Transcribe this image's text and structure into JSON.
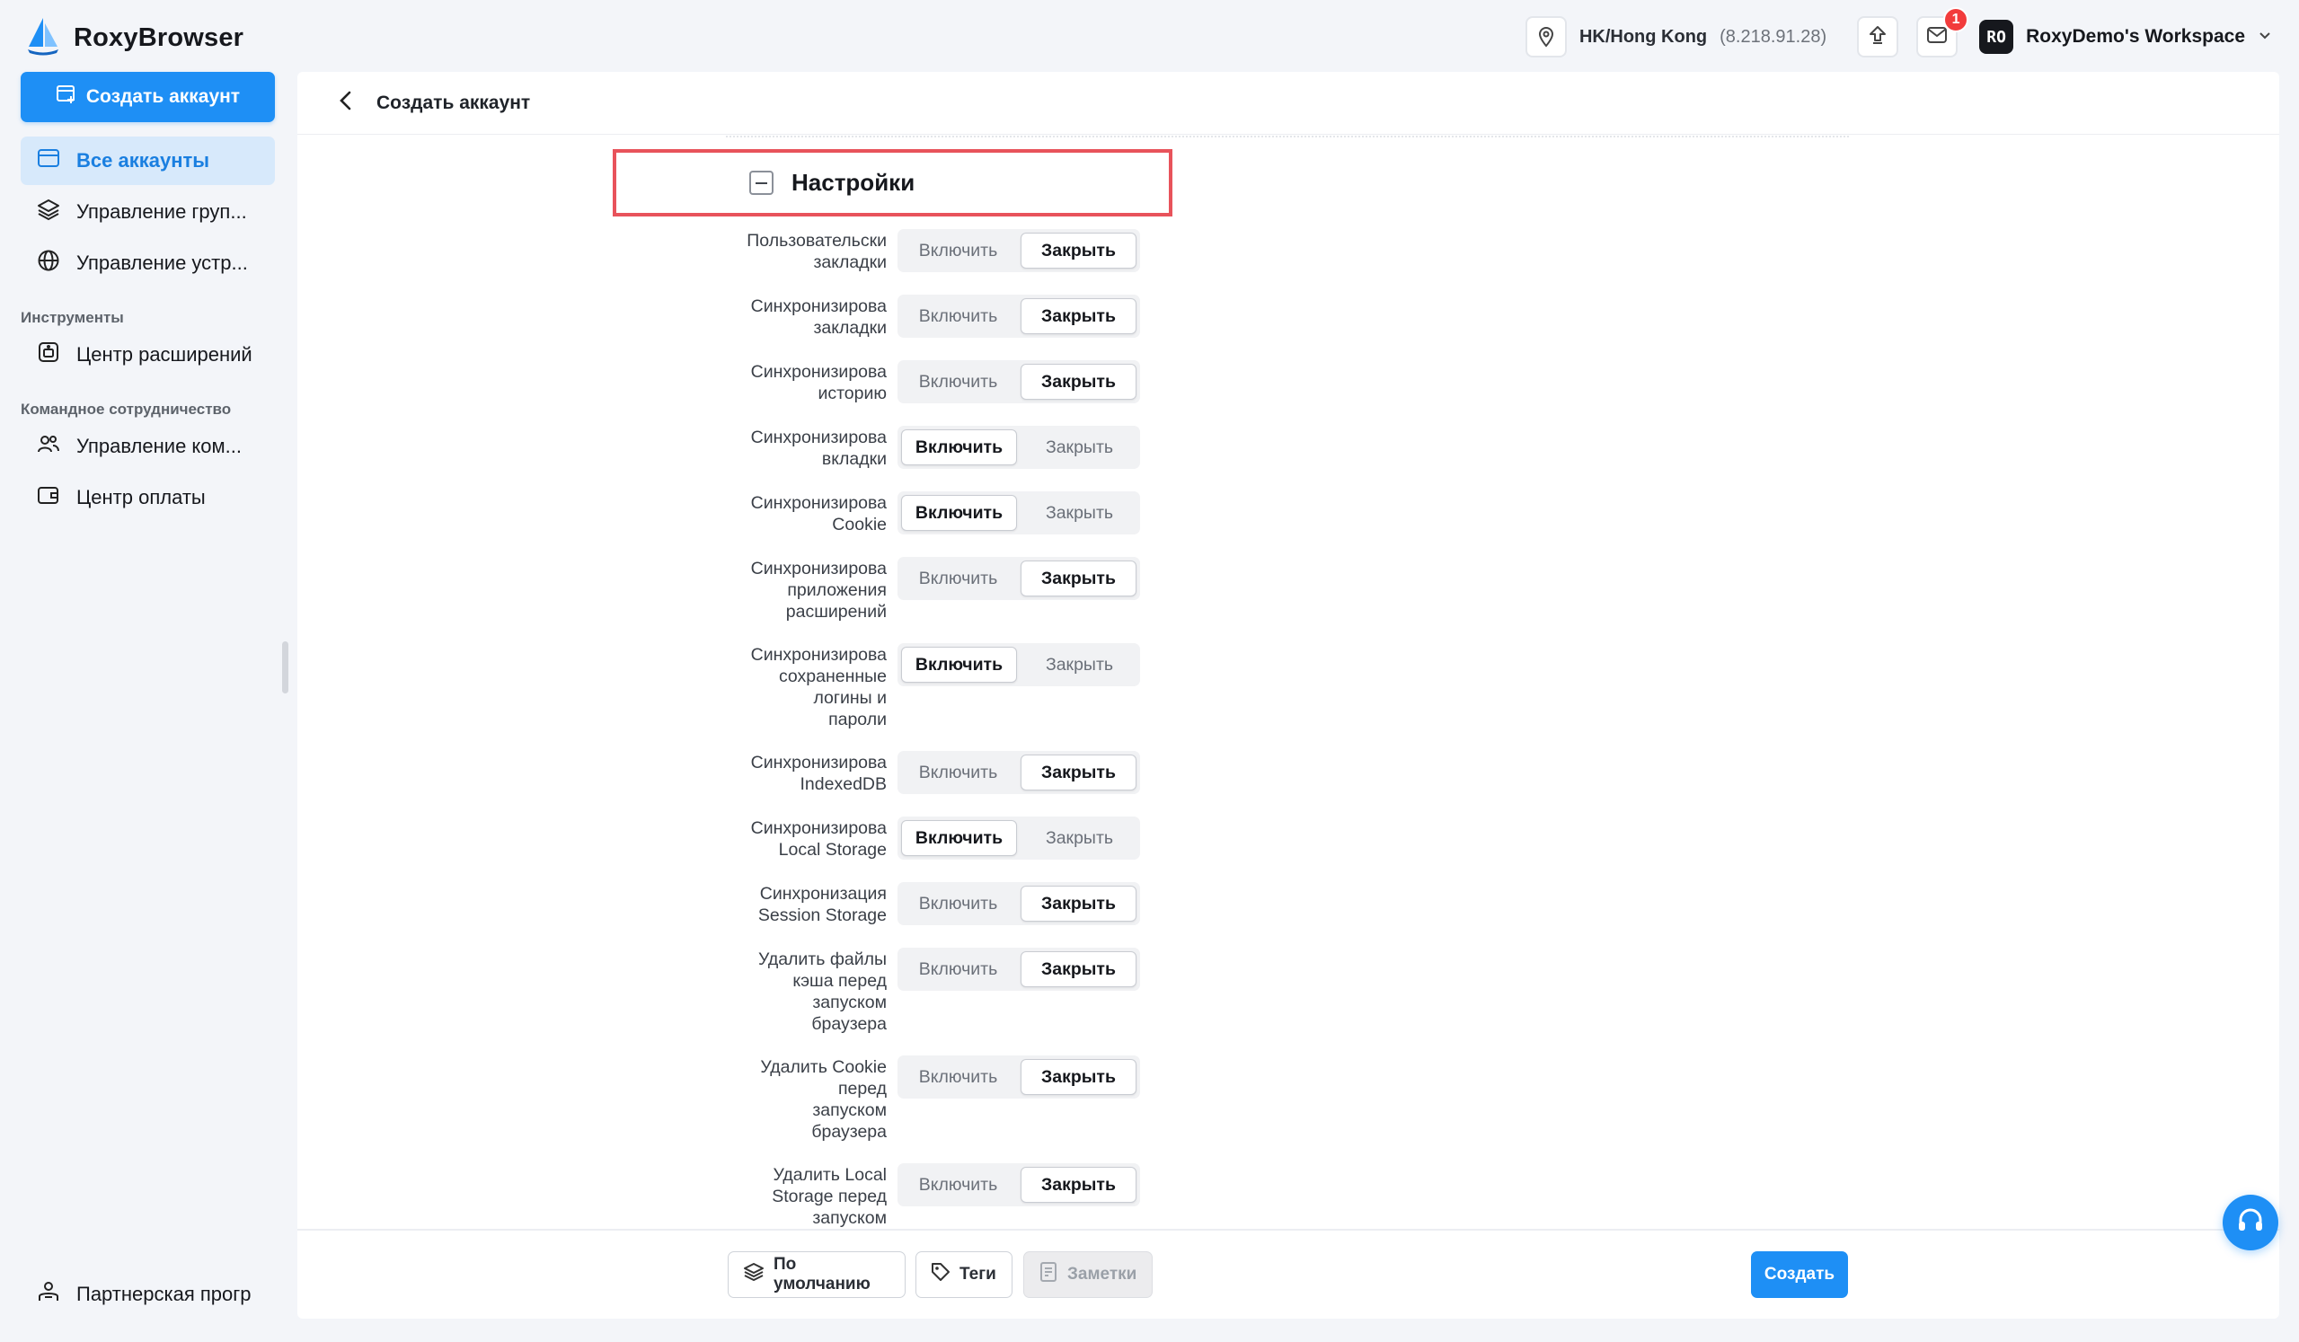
{
  "app": {
    "name": "RoxyBrowser"
  },
  "topbar": {
    "location": "HK/Hong Kong",
    "ip": "(8.218.91.28)",
    "mail_badge": "1",
    "workspace_initials": "RO",
    "workspace_name": "RoxyDemo's Workspace"
  },
  "sidebar": {
    "create_label": "Создать аккаунт",
    "items": [
      {
        "label": "Все аккаунты",
        "icon": "accounts-icon",
        "active": true
      },
      {
        "label": "Управление груп...",
        "icon": "layers-icon"
      },
      {
        "label": "Управление устр...",
        "icon": "globe-icon"
      }
    ],
    "section_tools": "Инструменты",
    "tools": [
      {
        "label": "Центр расширений",
        "icon": "extension-icon"
      }
    ],
    "section_team": "Командное сотрудничество",
    "team": [
      {
        "label": "Управление ком...",
        "icon": "users-icon"
      },
      {
        "label": "Центр оплаты",
        "icon": "wallet-icon"
      }
    ],
    "partner": "Партнерская прогр"
  },
  "main": {
    "title": "Создать аккаунт",
    "section_title": "Настройки",
    "on_label": "Включить",
    "off_label": "Закрыть",
    "settings": [
      {
        "label": "Пользовательски\nзакладки",
        "value": "off"
      },
      {
        "label": "Синхронизирова\nзакладки",
        "value": "off"
      },
      {
        "label": "Синхронизирова\nисторию",
        "value": "off"
      },
      {
        "label": "Синхронизирова\nвкладки",
        "value": "on"
      },
      {
        "label": "Синхронизирова\nCookie",
        "value": "on"
      },
      {
        "label": "Синхронизирова\nприложения\nрасширений",
        "value": "off"
      },
      {
        "label": "Синхронизирова\nсохраненные\nлогины и\nпароли",
        "value": "on"
      },
      {
        "label": "Синхронизирова\nIndexedDB",
        "value": "off"
      },
      {
        "label": "Синхронизирова\nLocal Storage",
        "value": "on"
      },
      {
        "label": "Синхронизация\nSession Storage",
        "value": "off"
      },
      {
        "label": "Удалить файлы\nкэша перед\nзапуском\nбраузера",
        "value": "off"
      },
      {
        "label": "Удалить Cookie\nперед\nзапуском\nбраузера",
        "value": "off"
      },
      {
        "label": "Удалить Local\nStorage перед\nзапуском",
        "value": "off"
      }
    ]
  },
  "footer": {
    "default_label": "По умолчанию",
    "tags_label": "Теги",
    "notes_label": "Заметки",
    "create_label": "Создать"
  },
  "colors": {
    "accent": "#1e8ff5",
    "highlight": "#e8535b",
    "badge": "#f23c3c"
  }
}
